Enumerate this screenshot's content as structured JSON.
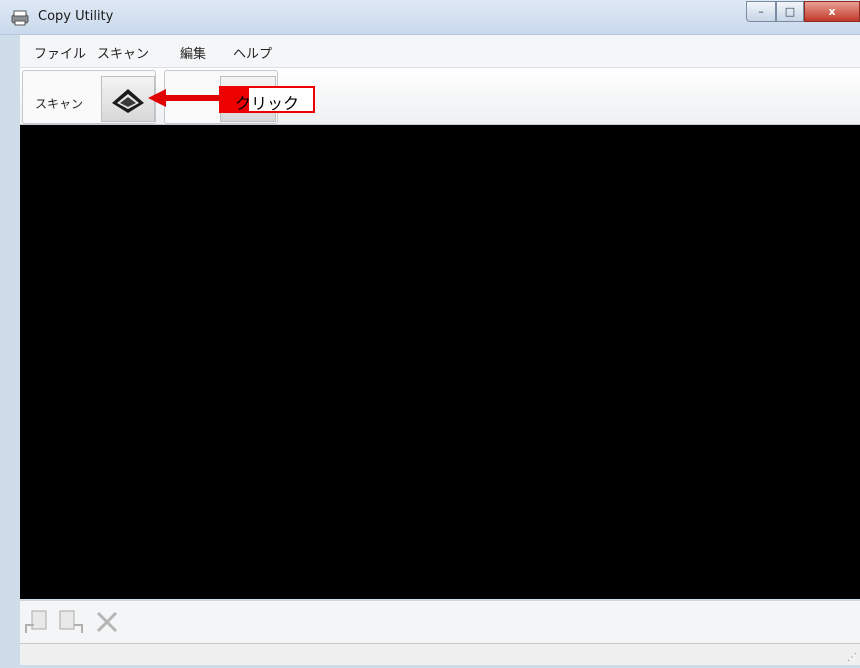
{
  "window": {
    "title": "Copy Utility",
    "controls": {
      "minimize": "–",
      "maximize": "□",
      "close": "x"
    }
  },
  "menu": {
    "items": [
      {
        "label": "ファイル"
      },
      {
        "label": "スキャン"
      },
      {
        "label": "編集"
      },
      {
        "label": "ヘルプ"
      }
    ]
  },
  "toolbar": {
    "scan_label": "スキャン",
    "scan_button_icon": "scanner-icon"
  },
  "callout": {
    "text": "クリック",
    "color": "#e00000"
  },
  "preview": {
    "background": "#000000"
  },
  "bottom_toolbar": {
    "icons": [
      "rotate-left-icon",
      "rotate-right-icon",
      "delete-icon"
    ]
  }
}
